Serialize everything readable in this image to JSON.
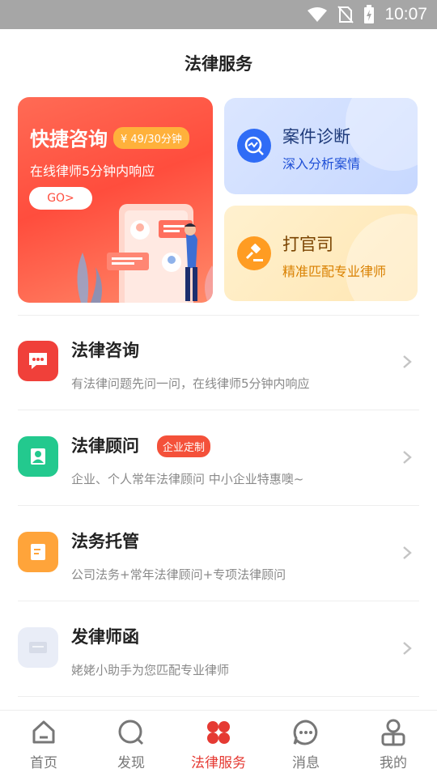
{
  "status_bar": {
    "time": "10:07"
  },
  "header": {
    "title": "法律服务"
  },
  "promo": {
    "title": "快捷咨询",
    "price": "¥ 49/30分钟",
    "subtitle": "在线律师5分钟内响应",
    "go_label": "GO>"
  },
  "cards": [
    {
      "title": "案件诊断",
      "subtitle": "深入分析案情",
      "icon": "chart-search-icon"
    },
    {
      "title": "打官司",
      "subtitle": "精准匹配专业律师",
      "icon": "gavel-icon"
    }
  ],
  "services": [
    {
      "name": "法律咨询",
      "desc": "有法律问题先问一问，在线律师5分钟内响应",
      "icon": "chat-bubble-icon",
      "color": "#f0403a"
    },
    {
      "name": "法律顾问",
      "badge": "企业定制",
      "desc": "企业、个人常年法律顾问 中小企业特惠噢~",
      "icon": "person-icon",
      "color": "#23c98e"
    },
    {
      "name": "法务托管",
      "desc": "公司法务+常年法律顾问+专项法律顾问",
      "icon": "document-icon",
      "color": "#ffa43a"
    },
    {
      "name": "发律师函",
      "desc": "姥姥小助手为您匹配专业律师",
      "icon": "letter-icon",
      "color": "#e9edf7"
    }
  ],
  "tabs": [
    {
      "label": "首页",
      "icon": "home-icon"
    },
    {
      "label": "发现",
      "icon": "discover-icon"
    },
    {
      "label": "法律服务",
      "icon": "legal-service-icon",
      "active": true
    },
    {
      "label": "消息",
      "icon": "message-icon"
    },
    {
      "label": "我的",
      "icon": "profile-icon"
    }
  ],
  "colors": {
    "accent": "#e53a33",
    "promo": "#ff5a45",
    "blue": "#2f6cf6",
    "orange": "#ff9c22"
  }
}
